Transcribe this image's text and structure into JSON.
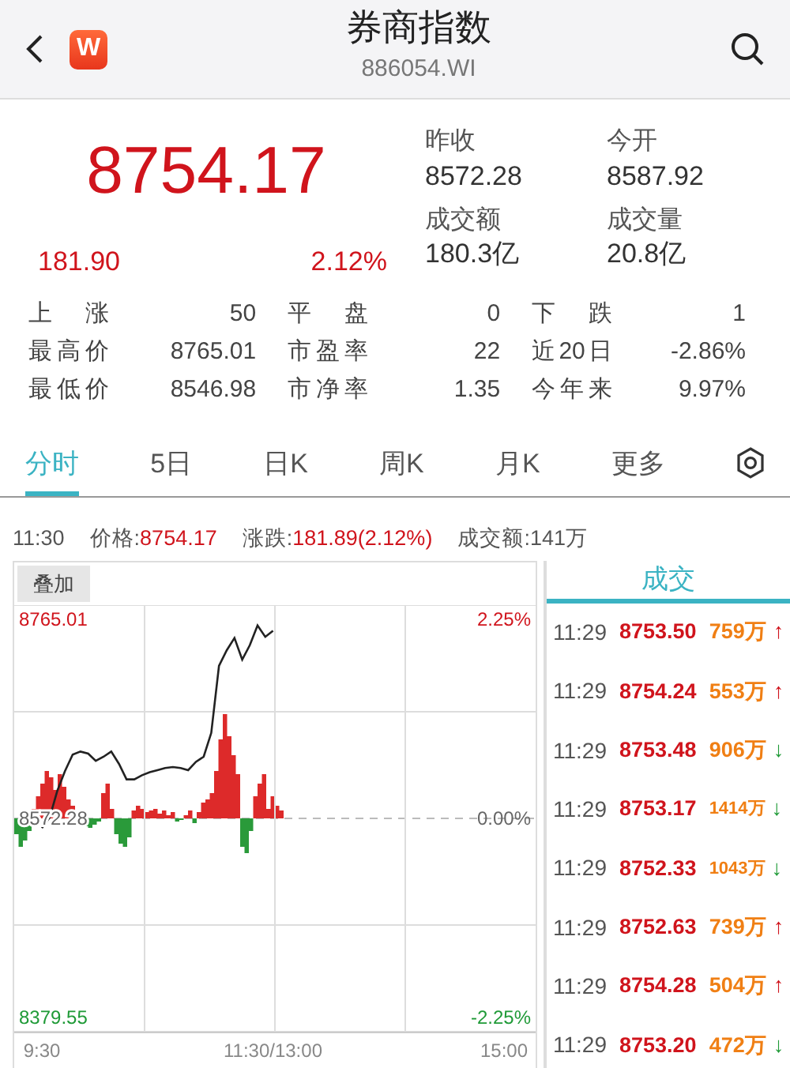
{
  "header": {
    "logo_text": "W",
    "title": "券商指数",
    "code": "886054.WI"
  },
  "quote": {
    "price": "8754.17",
    "change": "181.90",
    "change_pct": "2.12%",
    "fields": [
      {
        "label": "昨收",
        "value": "8572.28"
      },
      {
        "label": "今开",
        "value": "8587.92"
      },
      {
        "label": "成交额",
        "value": "180.3亿"
      },
      {
        "label": "成交量",
        "value": "20.8亿"
      }
    ]
  },
  "stats": [
    [
      {
        "label": "上 涨",
        "value": "50"
      },
      {
        "label": "平 盘",
        "value": "0"
      },
      {
        "label": "下 跌",
        "value": "1"
      }
    ],
    [
      {
        "label": "最高价",
        "value": "8765.01"
      },
      {
        "label": "市盈率",
        "value": "22"
      },
      {
        "label": "近20日",
        "value": "-2.86%"
      }
    ],
    [
      {
        "label": "最低价",
        "value": "8546.98"
      },
      {
        "label": "市净率",
        "value": "1.35"
      },
      {
        "label": "今年来",
        "value": "9.97%"
      }
    ]
  ],
  "tabs": [
    {
      "label": "分时",
      "selected": true
    },
    {
      "label": "5日",
      "selected": false
    },
    {
      "label": "日K",
      "selected": false
    },
    {
      "label": "周K",
      "selected": false
    },
    {
      "label": "月K",
      "selected": false
    },
    {
      "label": "更多",
      "selected": false
    }
  ],
  "info_line": {
    "time": "11:30",
    "price_label": "价格:",
    "price": "8754.17",
    "change_label": "涨跌:",
    "change": "181.89(2.12%)",
    "turnover": "成交额:141万"
  },
  "chart": {
    "overlay_button": "叠加",
    "percent_ticks": [
      "2.25%",
      "0.00%",
      "-2.25%"
    ],
    "chart_data": {
      "type": "line",
      "categories": [
        "9:30",
        null,
        null,
        null,
        null,
        null,
        null,
        null,
        null,
        null,
        null,
        null,
        null,
        null,
        null,
        null,
        null,
        null,
        null,
        null,
        null,
        null,
        null,
        null,
        null,
        null,
        null,
        null,
        null,
        null,
        "11:30/13:00",
        null,
        null,
        null,
        null,
        null,
        null,
        null,
        null,
        null,
        null,
        null,
        null,
        null,
        null,
        null,
        null,
        null,
        null,
        null,
        null,
        null,
        null,
        null,
        null,
        null,
        null,
        null,
        null,
        null,
        "15:00"
      ],
      "series": [
        {
          "color": "#222222",
          "values": [
            8563,
            8573,
            8599,
            8618,
            8634,
            8637,
            8635,
            8628,
            8632,
            8637,
            8625,
            8610,
            8610,
            8614,
            8617,
            8619,
            8621,
            8622,
            8621,
            8619,
            8627,
            8632,
            8655,
            8720,
            8735,
            8747,
            8726,
            8740,
            8759,
            8748,
            8754,
            null,
            null,
            null,
            null,
            null,
            null,
            null,
            null,
            null,
            null,
            null,
            null,
            null,
            null,
            null,
            null,
            null,
            null,
            null,
            null,
            null,
            null,
            null,
            null,
            null,
            null,
            null,
            null,
            null,
            null
          ]
        }
      ],
      "ylim": [
        8379.55,
        8765.01
      ],
      "yticks": [
        8765.01,
        8572.28,
        8379.55
      ]
    }
  },
  "trades_title": "成交",
  "trades": [
    {
      "time": "11:29",
      "price": "8753.50",
      "volume": "759万",
      "arrow": "↑",
      "kind": "up"
    },
    {
      "time": "11:29",
      "price": "8754.24",
      "volume": "553万",
      "arrow": "↑",
      "kind": "up"
    },
    {
      "time": "11:29",
      "price": "8753.48",
      "volume": "906万",
      "arrow": "↓",
      "kind": "down"
    },
    {
      "time": "11:29",
      "price": "8753.17",
      "volume": "1414万",
      "arrow": "↓",
      "kind": "down"
    },
    {
      "time": "11:29",
      "price": "8752.33",
      "volume": "1043万",
      "arrow": "↓",
      "kind": "down"
    },
    {
      "time": "11:29",
      "price": "8752.63",
      "volume": "739万",
      "arrow": "↑",
      "kind": "up"
    },
    {
      "time": "11:29",
      "price": "8754.28",
      "volume": "504万",
      "arrow": "↑",
      "kind": "up"
    },
    {
      "time": "11:29",
      "price": "8753.20",
      "volume": "472万",
      "arrow": "↓",
      "kind": "down"
    }
  ]
}
